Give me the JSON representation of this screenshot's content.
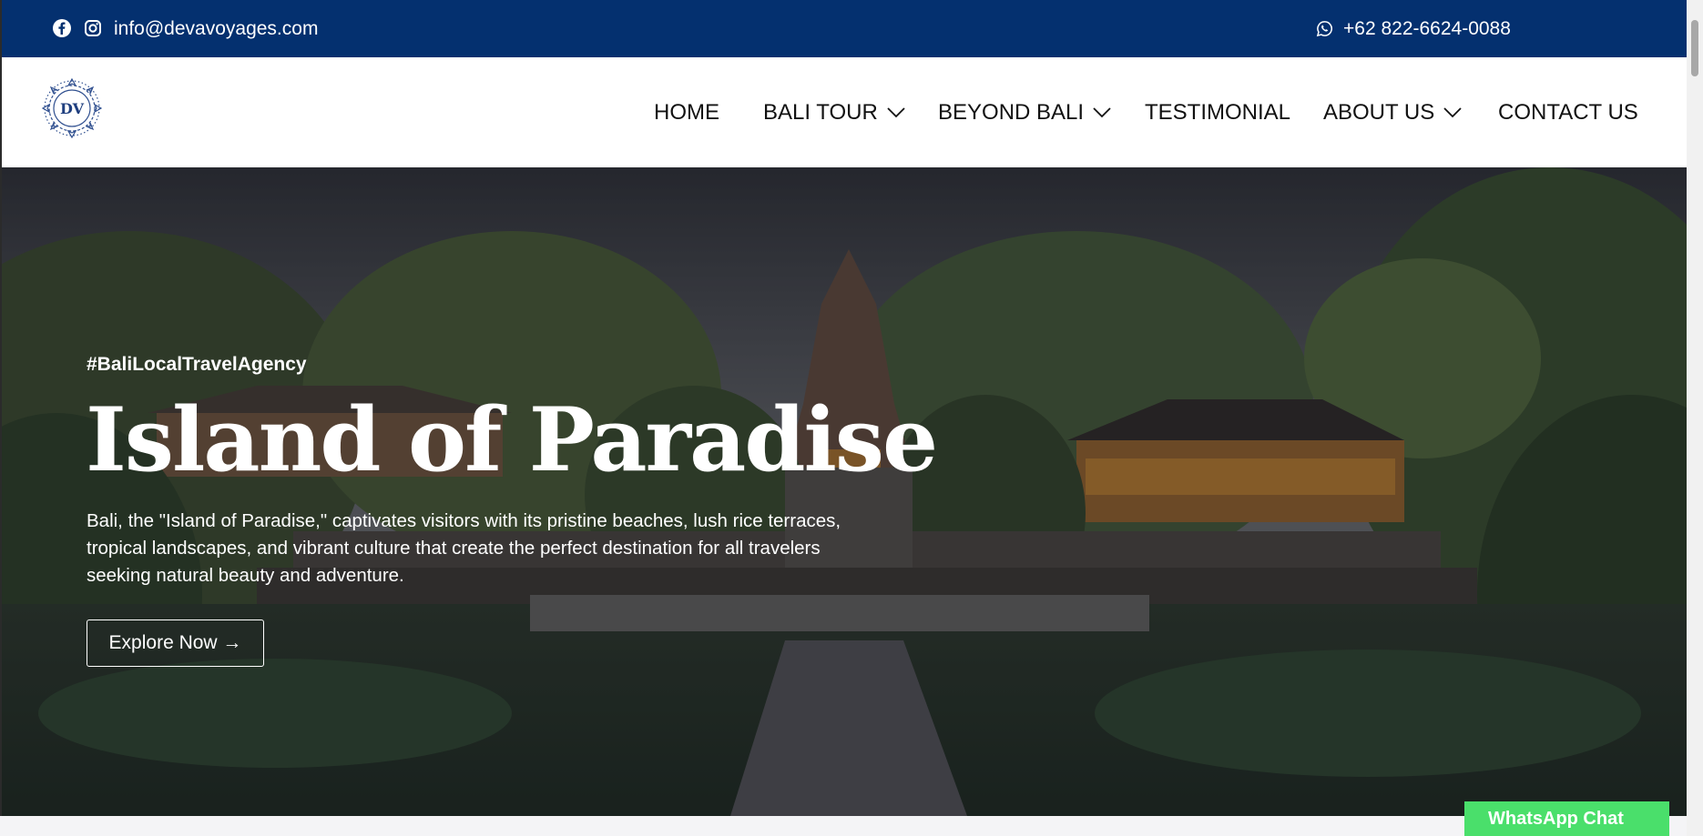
{
  "topbar": {
    "email": "info@devavoyages.com",
    "phone": "+62 822-6624-0088",
    "icons": [
      "facebook-icon",
      "instagram-icon",
      "whatsapp-icon"
    ],
    "bg_color": "#04306f"
  },
  "header": {
    "logo_text": "DV",
    "nav": [
      {
        "label": "HOME",
        "has_dropdown": false
      },
      {
        "label": "BALI TOUR",
        "has_dropdown": true
      },
      {
        "label": "BEYOND BALI",
        "has_dropdown": true
      },
      {
        "label": "TESTIMONIAL",
        "has_dropdown": false
      },
      {
        "label": "ABOUT US",
        "has_dropdown": true
      },
      {
        "label": "CONTACT US",
        "has_dropdown": false
      }
    ]
  },
  "hero": {
    "hashtag": "#BaliLocalTravelAgency",
    "title": "Island of Paradise",
    "description": "Bali, the \"Island of Paradise,\" captivates visitors with its pristine beaches, lush rice terraces, tropical landscapes, and vibrant culture that create the perfect destination for all travelers seeking natural beauty and adventure.",
    "cta_label": "Explore Now →"
  },
  "whatsapp_chat": {
    "label": "WhatsApp Chat",
    "color": "#4adf6b"
  }
}
